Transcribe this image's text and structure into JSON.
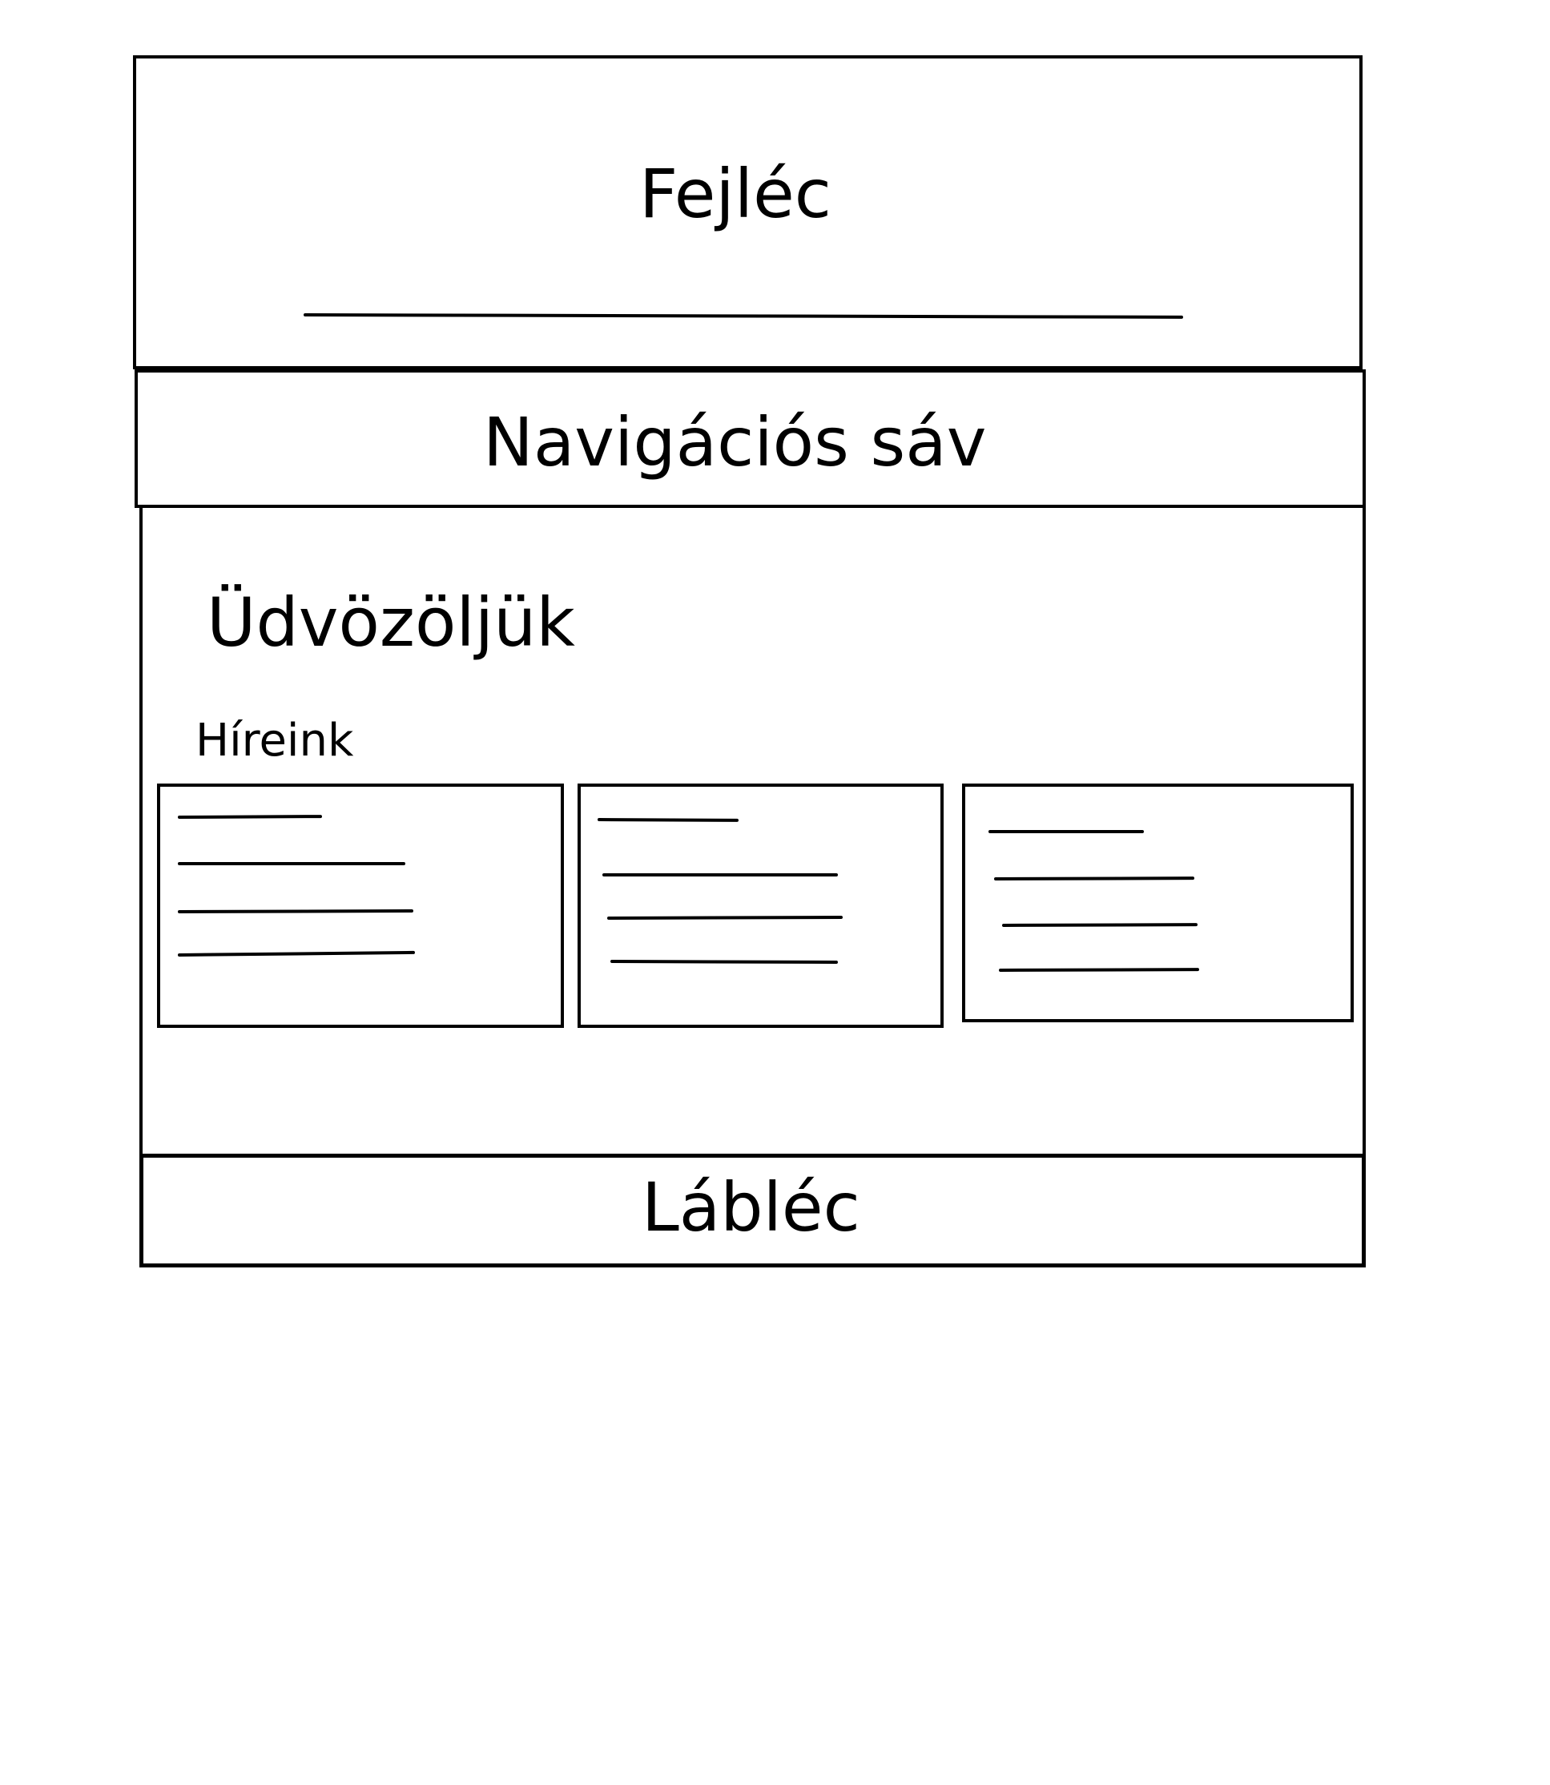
{
  "header": {
    "label": "Fejléc"
  },
  "nav": {
    "label": "Navigációs sáv"
  },
  "main": {
    "welcome": "Üdvözöljük",
    "news_heading": "Híreink",
    "news_cards": [
      {
        "line_count": 4
      },
      {
        "line_count": 4
      },
      {
        "line_count": 4
      }
    ]
  },
  "footer": {
    "label": "Lábléc"
  }
}
